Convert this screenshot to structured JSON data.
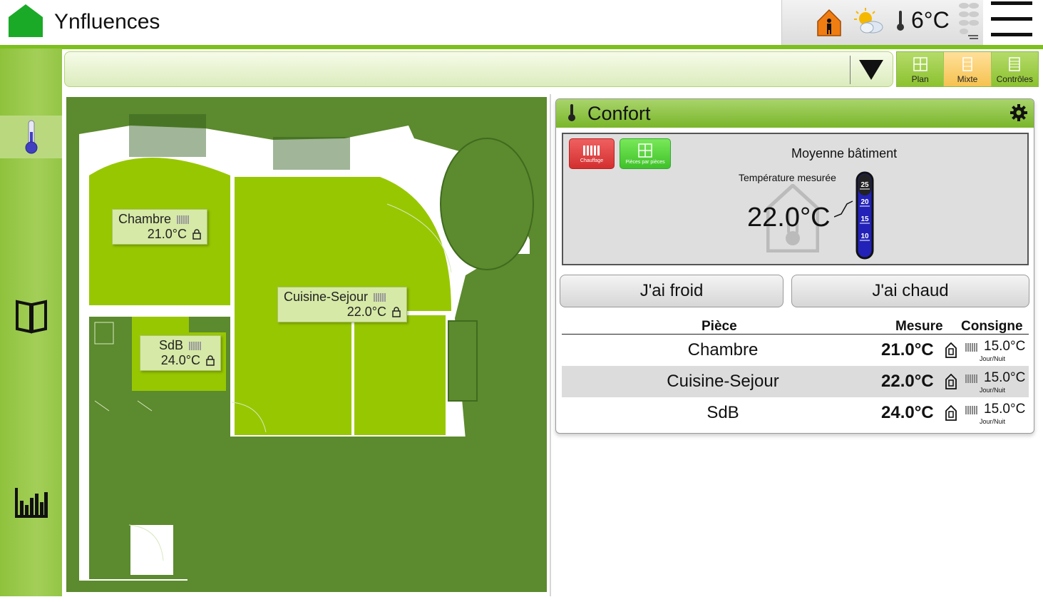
{
  "app": {
    "title": "Ynfluences"
  },
  "status": {
    "outside_temp": "6°C",
    "home_icon": "home-occupied-icon",
    "weather_icon": "partly-cloudy-icon",
    "wind_icon": "wind-icon"
  },
  "colors": {
    "accent_green": "#7cc01d",
    "plan_dark": "#5c8a2e",
    "plan_room": "#97c700",
    "active_tab": "#f6c250",
    "heating_red": "#d32f2f",
    "rooms_green": "#3fc22a"
  },
  "sidebar": {
    "items": [
      {
        "name": "thermometer-icon",
        "active": true
      },
      {
        "name": "book-icon",
        "active": false
      },
      {
        "name": "bar-chart-icon",
        "active": false
      }
    ]
  },
  "views": {
    "tabs": [
      {
        "label": "Plan",
        "active": false
      },
      {
        "label": "Mixte",
        "active": true
      },
      {
        "label": "Contrôles",
        "active": false
      }
    ]
  },
  "plan": {
    "rooms": [
      {
        "name": "Chambre",
        "temp": "21.0°C"
      },
      {
        "name": "Cuisine-Sejour",
        "temp": "22.0°C"
      },
      {
        "name": "SdB",
        "temp": "24.0°C"
      }
    ]
  },
  "confort": {
    "title": "Confort",
    "heating_button": "Chauffage",
    "rooms_button": "Pièces par pièces",
    "avg_title": "Moyenne bâtiment",
    "measured_label": "Température mesurée",
    "avg_value": "22.0°C",
    "gauge_ticks": [
      "25",
      "20",
      "15",
      "10"
    ],
    "cold_button": "J'ai froid",
    "hot_button": "J'ai chaud",
    "table": {
      "headers": {
        "room": "Pièce",
        "measure": "Mesure",
        "setpoint": "Consigne"
      },
      "rows": [
        {
          "room": "Chambre",
          "measure": "21.0°C",
          "setpoint": "15.0°C",
          "mode": "Jour/Nuit"
        },
        {
          "room": "Cuisine-Sejour",
          "measure": "22.0°C",
          "setpoint": "15.0°C",
          "mode": "Jour/Nuit"
        },
        {
          "room": "SdB",
          "measure": "24.0°C",
          "setpoint": "15.0°C",
          "mode": "Jour/Nuit"
        }
      ]
    }
  }
}
